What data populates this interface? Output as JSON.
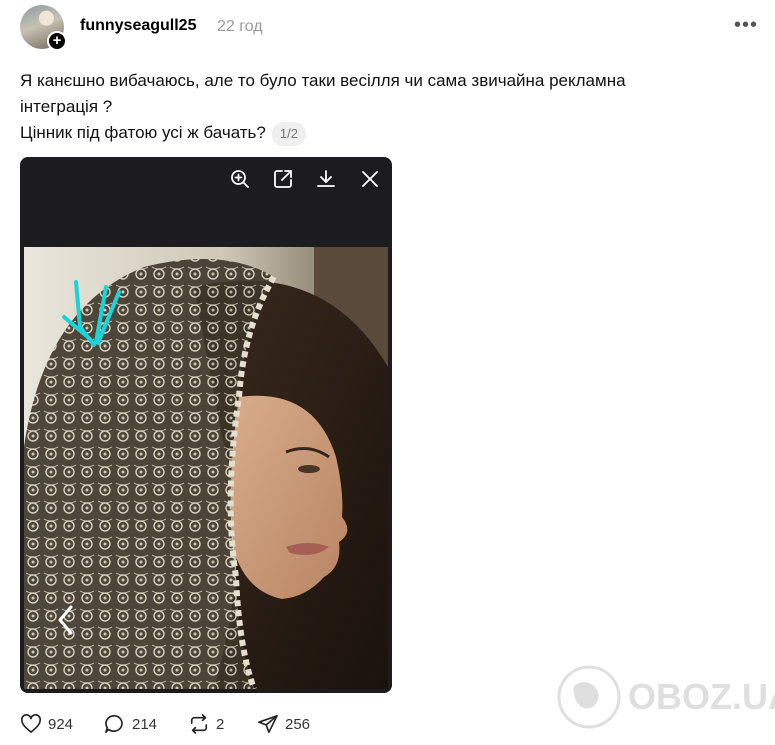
{
  "post": {
    "username": "funnyseagull25",
    "time": "22 год",
    "more_label": "•••",
    "text_line1": "Я канєшно вибачаюсь, але то було таки весілля чи сама звичайна рекламна",
    "text_line2": "інтеграція ?",
    "text_line3": "Цінник під фатою усі ж бачать?",
    "image_counter": "1/2"
  },
  "media_toolbar": {
    "icons": [
      "zoom-in-icon",
      "open-external-icon",
      "download-icon",
      "close-icon"
    ]
  },
  "actions": {
    "likes": "924",
    "comments": "214",
    "reposts": "2",
    "shares": "256"
  },
  "watermark": {
    "text": "OBOZ.UA"
  }
}
